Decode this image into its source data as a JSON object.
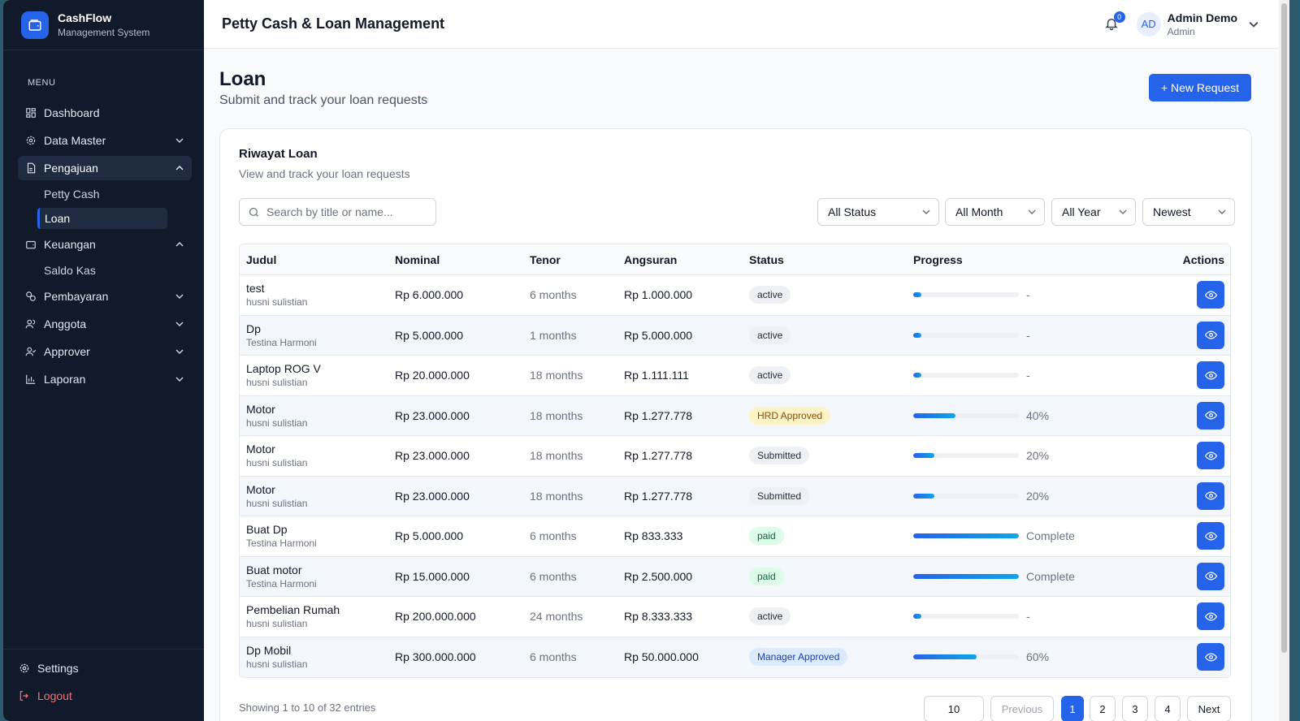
{
  "brand": {
    "name": "CashFlow",
    "subtitle": "Management System"
  },
  "menu_label": "MENU",
  "nav": {
    "dashboard": "Dashboard",
    "data_master": "Data Master",
    "pengajuan": "Pengajuan",
    "petty_cash": "Petty Cash",
    "loan": "Loan",
    "keuangan": "Keuangan",
    "saldo_kas": "Saldo Kas",
    "pembayaran": "Pembayaran",
    "anggota": "Anggota",
    "approver": "Approver",
    "laporan": "Laporan",
    "settings": "Settings",
    "logout": "Logout"
  },
  "header": {
    "title": "Petty Cash & Loan Management",
    "notification_count": "0",
    "user_initials": "AD",
    "user_name": "Admin Demo",
    "user_role": "Admin"
  },
  "page": {
    "title": "Loan",
    "subtitle": "Submit and track your loan requests",
    "new_button": "+ New Request"
  },
  "card": {
    "title": "Riwayat Loan",
    "subtitle": "View and track your loan requests",
    "search_placeholder": "Search by title or name..."
  },
  "filters": {
    "status": "All Status",
    "month": "All Month",
    "year": "All Year",
    "sort": "Newest"
  },
  "table": {
    "headers": {
      "judul": "Judul",
      "nominal": "Nominal",
      "tenor": "Tenor",
      "angsuran": "Angsuran",
      "status": "Status",
      "progress": "Progress",
      "actions": "Actions"
    },
    "rows": [
      {
        "title": "test",
        "name": "husni sulistian",
        "nominal": "Rp 6.000.000",
        "tenor": "6 months",
        "angsuran": "Rp 1.000.000",
        "status": "active",
        "progress": 0.08,
        "progress_label": "-"
      },
      {
        "title": "Dp",
        "name": "Testina Harmoni",
        "nominal": "Rp 5.000.000",
        "tenor": "1 months",
        "angsuran": "Rp 5.000.000",
        "status": "active",
        "progress": 0.08,
        "progress_label": "-"
      },
      {
        "title": "Laptop ROG V",
        "name": "husni sulistian",
        "nominal": "Rp 20.000.000",
        "tenor": "18 months",
        "angsuran": "Rp 1.111.111",
        "status": "active",
        "progress": 0.08,
        "progress_label": "-"
      },
      {
        "title": "Motor",
        "name": "husni sulistian",
        "nominal": "Rp 23.000.000",
        "tenor": "18 months",
        "angsuran": "Rp 1.277.778",
        "status": "HRD Approved",
        "progress": 0.4,
        "progress_label": "40%"
      },
      {
        "title": "Motor",
        "name": "husni sulistian",
        "nominal": "Rp 23.000.000",
        "tenor": "18 months",
        "angsuran": "Rp 1.277.778",
        "status": "Submitted",
        "progress": 0.2,
        "progress_label": "20%"
      },
      {
        "title": "Motor",
        "name": "husni sulistian",
        "nominal": "Rp 23.000.000",
        "tenor": "18 months",
        "angsuran": "Rp 1.277.778",
        "status": "Submitted",
        "progress": 0.2,
        "progress_label": "20%"
      },
      {
        "title": "Buat Dp",
        "name": "Testina Harmoni",
        "nominal": "Rp 5.000.000",
        "tenor": "6 months",
        "angsuran": "Rp 833.333",
        "status": "paid",
        "progress": 1.0,
        "progress_label": "Complete"
      },
      {
        "title": "Buat motor",
        "name": "Testina Harmoni",
        "nominal": "Rp 15.000.000",
        "tenor": "6 months",
        "angsuran": "Rp 2.500.000",
        "status": "paid",
        "progress": 1.0,
        "progress_label": "Complete"
      },
      {
        "title": "Pembelian Rumah",
        "name": "husni sulistian",
        "nominal": "Rp 200.000.000",
        "tenor": "24 months",
        "angsuran": "Rp 8.333.333",
        "status": "active",
        "progress": 0.08,
        "progress_label": "-"
      },
      {
        "title": "Dp Mobil",
        "name": "husni sulistian",
        "nominal": "Rp 300.000.000",
        "tenor": "6 months",
        "angsuran": "Rp 50.000.000",
        "status": "Manager Approved",
        "progress": 0.6,
        "progress_label": "60%"
      }
    ]
  },
  "footer": {
    "showing": "Showing 1 to 10 of 32 entries",
    "page_size": "10",
    "previous": "Previous",
    "pages": [
      "1",
      "2",
      "3",
      "4"
    ],
    "next": "Next"
  },
  "colors": {
    "primary": "#2563eb",
    "sidebar": "#111a2b"
  }
}
